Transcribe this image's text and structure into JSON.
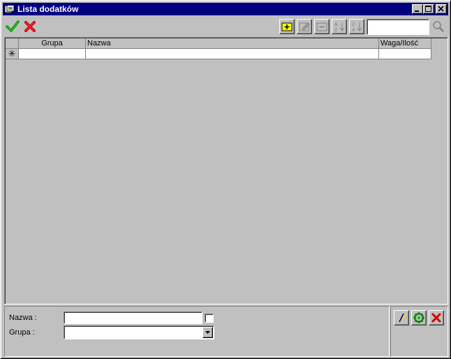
{
  "window": {
    "title": "Lista dodatków"
  },
  "toolbar": {
    "accept_icon": "check-icon",
    "cancel_icon": "x-icon",
    "search_value": ""
  },
  "grid": {
    "columns": [
      {
        "label": "Grupa"
      },
      {
        "label": "Nazwa"
      },
      {
        "label": "Waga/Ilość"
      }
    ],
    "new_row_marker": "✳"
  },
  "form": {
    "name_label": "Nazwa :",
    "name_value": "",
    "group_label": "Grupa :",
    "group_value": ""
  },
  "colors": {
    "title_bar": "#000080",
    "accent_green": "#00a000",
    "accent_red": "#e00000"
  }
}
